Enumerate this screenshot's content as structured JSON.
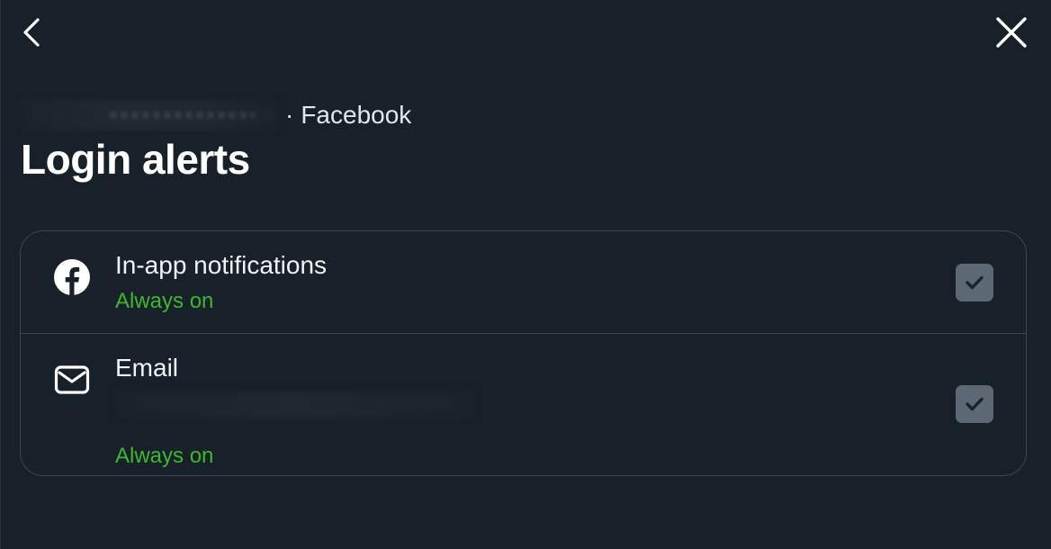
{
  "header": {
    "back_icon": "chevron-left-icon",
    "close_icon": "close-icon"
  },
  "account": {
    "separator": "·",
    "platform": "Facebook"
  },
  "title": "Login alerts",
  "options": [
    {
      "label": "In-app notifications",
      "status": "Always on",
      "icon": "facebook-icon",
      "checked": true
    },
    {
      "label": "Email",
      "status": "Always on",
      "icon": "mail-icon",
      "checked": true
    }
  ],
  "colors": {
    "background": "#18202a",
    "status_green": "#3bb82d",
    "checkbox": "#5d6875",
    "border": "#3c4754"
  }
}
